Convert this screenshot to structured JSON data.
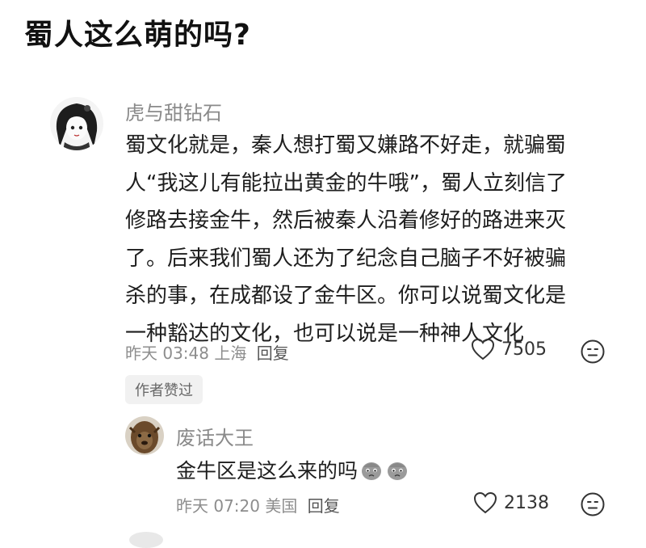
{
  "post": {
    "title": "蜀人这么萌的吗?"
  },
  "comment": {
    "username": "虎与甜钻石",
    "lines": [
      "蜀文化就是，秦人想打蜀又嫌路不好走，就骗蜀",
      "人“我这儿有能拉出黄金的牛哦”，蜀人立刻信了",
      "修路去接金牛，然后被秦人沿着修好的路进来灭",
      "了。后来我们蜀人还为了纪念自己脑子不好被骗",
      "杀的事，在成都设了金牛区。你可以说蜀文化是",
      "一种豁达的文化，也可以说是一种神人文化"
    ],
    "meta": "昨天 03:48 上海",
    "reply_label": "回复",
    "likes": "7505",
    "badge": "作者赞过"
  },
  "reply": {
    "username": "废话大王",
    "text": "金牛区是这么来的吗",
    "meta": "昨天 07:20 美国",
    "reply_label": "回复",
    "likes": "2138"
  },
  "colors": {
    "meta_gray": "#8d8d8d",
    "text": "#1e1e1e",
    "badge_bg": "#f1f1f1"
  },
  "icons": [
    "heart-icon",
    "emoji-react-icon",
    "crying-emoji"
  ]
}
